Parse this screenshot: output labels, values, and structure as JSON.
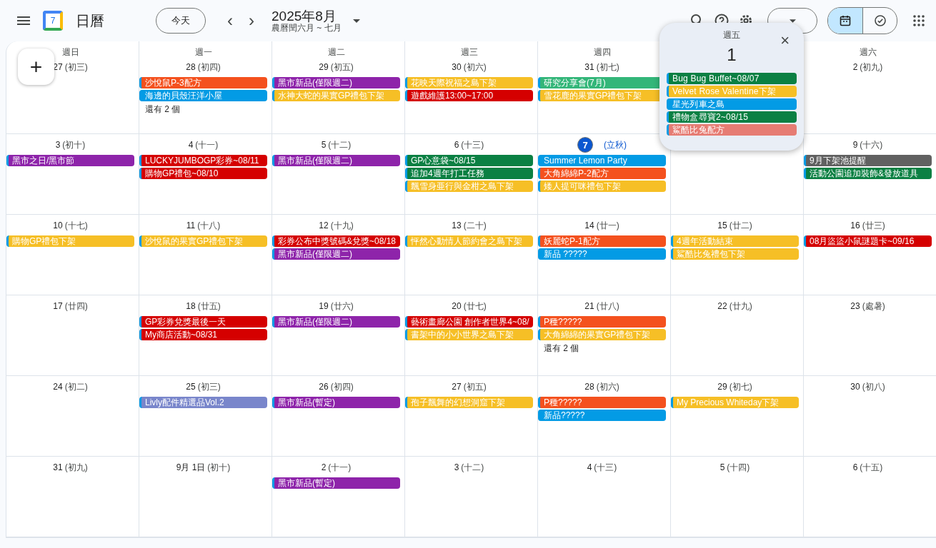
{
  "app": {
    "name": "日曆",
    "logo_day": "7"
  },
  "toolbar": {
    "today_button": "今天",
    "prev": "‹",
    "next": "›",
    "month_title": "2025年8月",
    "lunar_subtitle": "農曆閏六月 ~ 七月",
    "view_toggle": [
      {
        "kind": "calendar",
        "selected": true
      },
      {
        "kind": "tasks",
        "selected": false
      }
    ]
  },
  "create_button": "+",
  "weeks": [
    [
      {
        "weekday": "週日",
        "date": "27",
        "lunar": "(初三)",
        "today": false
      },
      {
        "weekday": "週一",
        "date": "28",
        "lunar": "(初四)",
        "today": false,
        "events": [
          {
            "title": "沙悅鼠P-3配方",
            "color": "#f4511e"
          },
          {
            "title": "海邊的貝殼汪洋小屋",
            "color": "#039be5"
          }
        ],
        "more": "還有 2 個"
      },
      {
        "weekday": "週二",
        "date": "29",
        "lunar": "(初五)",
        "today": false,
        "events": [
          {
            "title": "黑市新品(僅限週二)",
            "color": "#8e24aa"
          },
          {
            "title": "水神大蛇的果實GP禮包下架",
            "color": "#f6bf26"
          }
        ]
      },
      {
        "weekday": "週三",
        "date": "30",
        "lunar": "(初六)",
        "today": false,
        "events": [
          {
            "title": "花映天際祝福之島下架",
            "color": "#f6bf26"
          },
          {
            "title": "遊戲維護13:00~17:00",
            "color": "#d50000"
          }
        ]
      },
      {
        "weekday": "週四",
        "date": "31",
        "lunar": "(初七)",
        "today": false,
        "events": [
          {
            "title": "研究分享會(7月)",
            "color": "#33b679"
          },
          {
            "title": "雪花鹿的果實GP禮包下架",
            "color": "#f6bf26"
          }
        ]
      },
      {
        "popup": {
          "weekday": "週五",
          "day": "1",
          "close": "×",
          "events": [
            {
              "title": "Bug Bug Buffet~08/07",
              "color": "#0b8043"
            },
            {
              "title": "Velvet Rose Valentine下架",
              "color": "#f6bf26"
            },
            {
              "title": "星光列車之島",
              "color": "#039be5"
            },
            {
              "title": "禮物盒尋寶2~08/15",
              "color": "#0b8043"
            },
            {
              "title": "鯊酷比兔配方",
              "color": "#e67c73"
            }
          ]
        }
      },
      {
        "weekday": "週六",
        "date": "2",
        "lunar": "(初九)",
        "today": false
      }
    ],
    [
      {
        "date": "3",
        "lunar": "(初十)",
        "today": false,
        "events": [
          {
            "title": "黑市之日/黑市節",
            "color": "#8e24aa"
          }
        ]
      },
      {
        "date": "4",
        "lunar": "(十一)",
        "today": false,
        "events": [
          {
            "title": "LUCKYJUMBOGP彩券~08/11",
            "color": "#d50000"
          },
          {
            "title": "購物GP禮包~08/10",
            "color": "#d50000"
          }
        ]
      },
      {
        "date": "5",
        "lunar": "(十二)",
        "today": false,
        "events": [
          {
            "title": "黑市新品(僅限週二)",
            "color": "#8e24aa"
          }
        ]
      },
      {
        "date": "6",
        "lunar": "(十三)",
        "today": false,
        "events": [
          {
            "title": "GP心意袋~08/15",
            "color": "#0b8043"
          },
          {
            "title": "追加4週年打工任務",
            "color": "#0b8043"
          },
          {
            "title": "飄雪身亜行與金柑之島下架",
            "color": "#f6bf26"
          }
        ]
      },
      {
        "date": "7",
        "lunar": "(立秋)",
        "today": true,
        "events": [
          {
            "title": "Summer Lemon Party",
            "color": "#039be5"
          },
          {
            "title": "大角綿綿P-2配方",
            "color": "#f4511e"
          },
          {
            "title": "矮人提可咪禮包下架",
            "color": "#f6bf26"
          }
        ]
      },
      {
        "date": "9",
        "lunar": "(十六)",
        "today": false,
        "events": [
          {
            "title": "9月下架池提醒",
            "color": "#616161"
          },
          {
            "title": "活動公園追加裝飾&發放道具",
            "color": "#0b8043"
          }
        ]
      }
    ],
    [
      {
        "date": "10",
        "lunar": "(十七)",
        "today": false,
        "events": [
          {
            "title": "購物GP禮包下架",
            "color": "#f6bf26"
          }
        ]
      },
      {
        "date": "11",
        "lunar": "(十八)",
        "today": false,
        "events": [
          {
            "title": "沙悅鼠的果實GP禮包下架",
            "color": "#f6bf26"
          }
        ]
      },
      {
        "date": "12",
        "lunar": "(十九)",
        "today": false,
        "events": [
          {
            "title": "彩券公布中獎號碼&兌獎~08/18",
            "color": "#d50000"
          },
          {
            "title": "黑市新品(僅限週二)",
            "color": "#8e24aa"
          }
        ]
      },
      {
        "date": "13",
        "lunar": "(二十)",
        "today": false,
        "events": [
          {
            "title": "怦然心動情人節約會之島下架",
            "color": "#f6bf26"
          }
        ]
      },
      {
        "date": "14",
        "lunar": "(廿一)",
        "today": false,
        "events": [
          {
            "title": "妖麗蛇P-1配方",
            "color": "#f4511e"
          },
          {
            "title": "新品 ?????",
            "color": "#039be5"
          }
        ]
      },
      {
        "date": "15",
        "lunar": "(廿二)",
        "today": false,
        "events": [
          {
            "title": "4週年活動結束",
            "color": "#f6bf26"
          },
          {
            "title": "鯊酷比兔禮包下架",
            "color": "#f6bf26"
          }
        ]
      },
      {
        "date": "16",
        "lunar": "(廿三)",
        "today": false,
        "events": [
          {
            "title": "08月盜盜小鼠謎題卡~09/16",
            "color": "#d50000"
          }
        ]
      }
    ],
    [
      {
        "date": "17",
        "lunar": "(廿四)",
        "today": false
      },
      {
        "date": "18",
        "lunar": "(廿五)",
        "today": false,
        "events": [
          {
            "title": "GP彩券兌獎最後一天",
            "color": "#d50000"
          },
          {
            "title": "My商店活動~08/31",
            "color": "#d50000"
          }
        ]
      },
      {
        "date": "19",
        "lunar": "(廿六)",
        "today": false,
        "events": [
          {
            "title": "黑市新品(僅限週二)",
            "color": "#8e24aa"
          }
        ]
      },
      {
        "date": "20",
        "lunar": "(廿七)",
        "today": false,
        "events": [
          {
            "title": "藝術畫廊公園 創作者世界4~08/",
            "color": "#d50000"
          },
          {
            "title": "書架中的小小世界之島下架",
            "color": "#f6bf26"
          }
        ]
      },
      {
        "date": "21",
        "lunar": "(廿八)",
        "today": false,
        "events": [
          {
            "title": "P種?????",
            "color": "#f4511e"
          },
          {
            "title": "大角綿綿的果實GP禮包下架",
            "color": "#f6bf26"
          }
        ],
        "more": "還有 2 個"
      },
      {
        "date": "22",
        "lunar": "(廿九)",
        "today": false
      },
      {
        "date": "23",
        "lunar": "(處暑)",
        "today": false
      }
    ],
    [
      {
        "date": "24",
        "lunar": "(初二)",
        "today": false
      },
      {
        "date": "25",
        "lunar": "(初三)",
        "today": false,
        "events": [
          {
            "title": "Livly配件精選品Vol.2",
            "color": "#7986cb"
          }
        ]
      },
      {
        "date": "26",
        "lunar": "(初四)",
        "today": false,
        "events": [
          {
            "title": "黑市新品(暫定)",
            "color": "#8e24aa"
          }
        ]
      },
      {
        "date": "27",
        "lunar": "(初五)",
        "today": false,
        "events": [
          {
            "title": "孢子飄舞的幻想洞窟下架",
            "color": "#f6bf26"
          }
        ]
      },
      {
        "date": "28",
        "lunar": "(初六)",
        "today": false,
        "events": [
          {
            "title": "P種?????",
            "color": "#f4511e"
          },
          {
            "title": "新品?????",
            "color": "#039be5"
          }
        ]
      },
      {
        "date": "29",
        "lunar": "(初七)",
        "today": false,
        "events": [
          {
            "title": "My Precious Whiteday下架",
            "color": "#f6bf26"
          }
        ]
      },
      {
        "date": "30",
        "lunar": "(初八)",
        "today": false
      }
    ],
    [
      {
        "date": "31",
        "lunar": "(初九)",
        "today": false
      },
      {
        "date": "9月 1日",
        "lunar": "(初十)",
        "today": false
      },
      {
        "date": "2",
        "lunar": "(十一)",
        "today": false,
        "events": [
          {
            "title": "黑市新品(暫定)",
            "color": "#8e24aa"
          }
        ]
      },
      {
        "date": "3",
        "lunar": "(十二)",
        "today": false
      },
      {
        "date": "4",
        "lunar": "(十三)",
        "today": false
      },
      {
        "date": "5",
        "lunar": "(十四)",
        "today": false
      },
      {
        "date": "6",
        "lunar": "(十五)",
        "today": false
      }
    ]
  ]
}
